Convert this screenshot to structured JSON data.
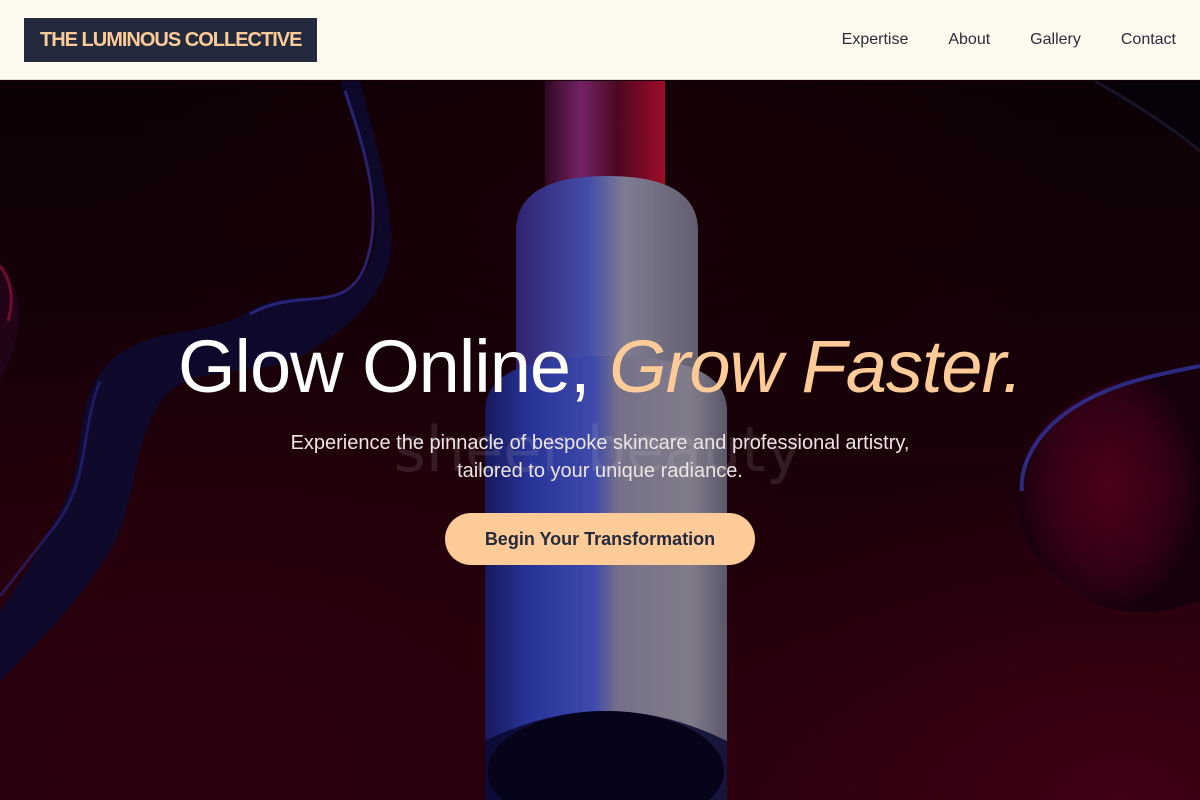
{
  "header": {
    "logo_text": "THE LUMINOUS COLLECTIVE",
    "nav": [
      {
        "label": "Expertise"
      },
      {
        "label": "About"
      },
      {
        "label": "Gallery"
      },
      {
        "label": "Contact"
      }
    ]
  },
  "hero": {
    "title_main": "Glow Online,",
    "title_accent": "Grow Faster.",
    "subtitle_line1": "Experience the pinnacle of bespoke skincare and professional artistry,",
    "subtitle_line2": "tailored to your unique radiance.",
    "cta_label": "Begin Your Transformation",
    "background_bottle_text": "sheer beauty"
  },
  "colors": {
    "header_bg": "#fffaee",
    "logo_bg": "#232a3d",
    "accent_peach": "#fccb98",
    "nav_text": "#2a2d3a",
    "hero_bg": "#1a0209"
  }
}
